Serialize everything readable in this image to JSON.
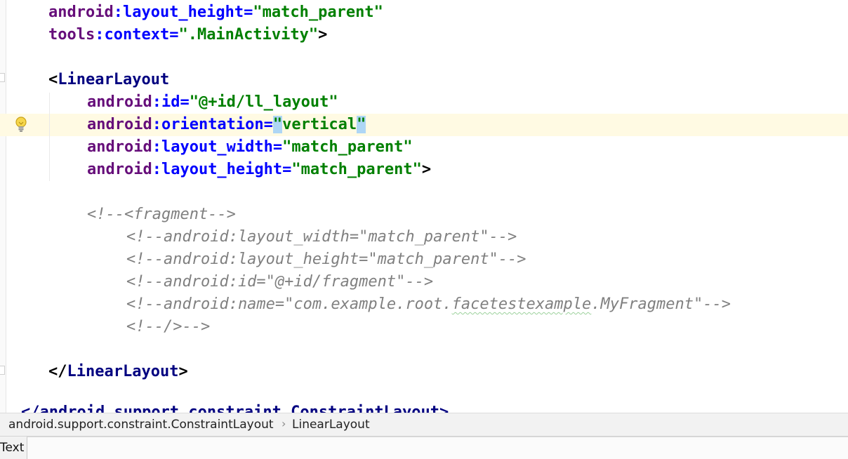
{
  "editor": {
    "file_type": "xml",
    "lines": [
      {
        "tokens": [
          [
            "ns",
            "android"
          ],
          [
            "at",
            ":layout_height="
          ],
          [
            "val",
            "\"match_parent\""
          ]
        ]
      },
      {
        "tokens": [
          [
            "ns",
            "tools"
          ],
          [
            "at",
            ":context="
          ],
          [
            "val",
            "\".MainActivity\""
          ],
          [
            "plain",
            ">"
          ]
        ]
      },
      {
        "tokens": []
      },
      {
        "tokens": [
          [
            "plain",
            "<"
          ],
          [
            "tag",
            "LinearLayout"
          ]
        ]
      },
      {
        "tokens": [
          [
            "ns",
            "android"
          ],
          [
            "at",
            ":id="
          ],
          [
            "val",
            "\"@+id/ll_layout\""
          ]
        ]
      },
      {
        "tokens": [
          [
            "ns",
            "android"
          ],
          [
            "at",
            ":orientation="
          ],
          [
            "valm",
            "\""
          ],
          [
            "val",
            "vertical"
          ],
          [
            "valm",
            "\""
          ]
        ]
      },
      {
        "tokens": [
          [
            "ns",
            "android"
          ],
          [
            "at",
            ":layout_width="
          ],
          [
            "val",
            "\"match_parent\""
          ]
        ]
      },
      {
        "tokens": [
          [
            "ns",
            "android"
          ],
          [
            "at",
            ":layout_height="
          ],
          [
            "val",
            "\"match_parent\""
          ],
          [
            "plain",
            ">"
          ]
        ]
      },
      {
        "tokens": []
      },
      {
        "tokens": [
          [
            "cm",
            "<!--<fragment-->"
          ]
        ]
      },
      {
        "tokens": [
          [
            "cm",
            "<!--android:layout_width=\"match_parent\"-->"
          ]
        ]
      },
      {
        "tokens": [
          [
            "cm",
            "<!--android:layout_height=\"match_parent\"-->"
          ]
        ]
      },
      {
        "tokens": [
          [
            "cm",
            "<!--android:id=\"@+id/fragment\"-->"
          ]
        ]
      },
      {
        "tokens": [
          [
            "cm",
            "<!--android:name=\"com.example.root."
          ],
          [
            "cmsq",
            "facetestexample"
          ],
          [
            "cm",
            ".MyFragment\"-->"
          ]
        ]
      },
      {
        "tokens": [
          [
            "cm",
            "<!--/>-->"
          ]
        ]
      },
      {
        "tokens": []
      },
      {
        "tokens": [
          [
            "plain",
            "</"
          ],
          [
            "tag",
            "LinearLayout"
          ],
          [
            "plain",
            ">"
          ]
        ]
      }
    ],
    "cut_off_line": "</android.support.constraint.ConstraintLayout>",
    "intention_icon": "lightbulb-icon",
    "highlight_colors": {
      "caret_row": "#fffae3",
      "brace_match": "#aed6f5",
      "namespace": "#660e7a",
      "attribute": "#0000ff",
      "tag": "#000080",
      "value": "#008000",
      "comment": "#808080"
    }
  },
  "breadcrumb": {
    "items": [
      "android.support.constraint.ConstraintLayout",
      "LinearLayout"
    ],
    "separator": "›"
  },
  "bottom_tabs": {
    "text_tab": "Text"
  }
}
